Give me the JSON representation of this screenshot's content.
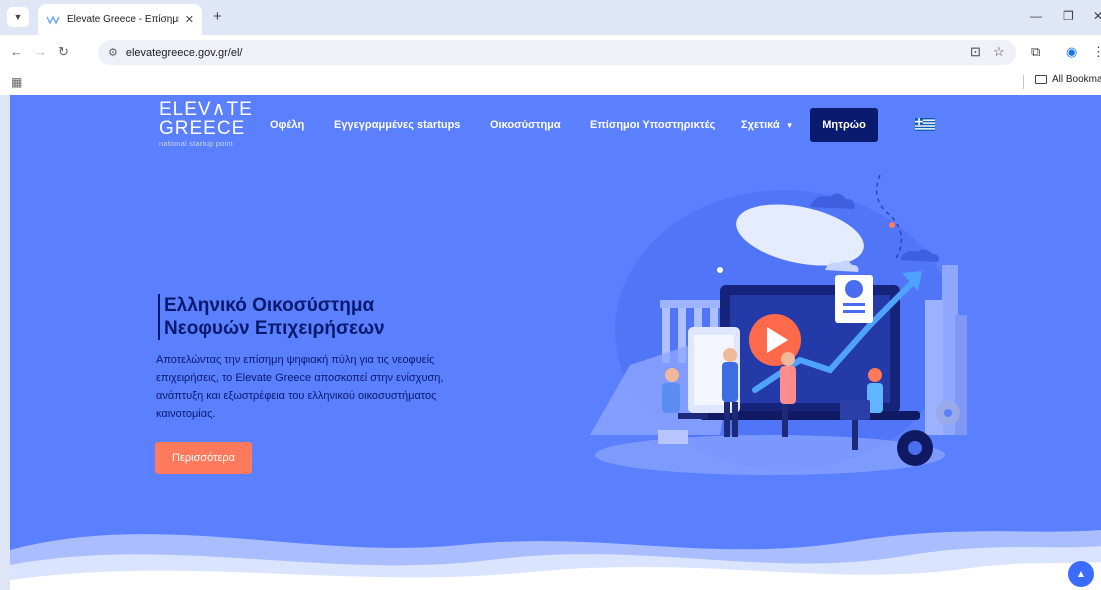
{
  "browser": {
    "tab_title": "Elevate Greece - Επίσημη ψηφι...",
    "url": "elevategreece.gov.gr/el/",
    "all_bookmarks": "All Bookmarks"
  },
  "site": {
    "logo_line1": "ELEV∧TE",
    "logo_line2": "GREECE",
    "logo_line3": "national startup point",
    "nav": [
      {
        "label": "Οφέλη"
      },
      {
        "label": "Εγγεγραμμένες startups"
      },
      {
        "label": "Οικοσύστημα"
      },
      {
        "label": "Επίσημοι Υποστηρικτές"
      },
      {
        "label": "Σχετικά"
      }
    ],
    "register_label": "Μητρώο",
    "colors": {
      "hero_bg": "#5a7fff",
      "dark_navy": "#0a1a6e",
      "cta": "#ff7a5c"
    }
  },
  "hero": {
    "title_line1": "Ελληνικό Οικοσύστημα",
    "title_line2": "Νεοφυών Επιχειρήσεων",
    "description": "Αποτελώντας την επίσημη ψηφιακή πύλη για τις νεοφυείς επιχειρήσεις, το Elevate Greece αποσκοπεί στην ενίσχυση, ανάπτυξη και εξωστρέφεια του ελληνικού οικοσυστήματος καινοτομίας.",
    "cta_label": "Περισσότερα"
  }
}
